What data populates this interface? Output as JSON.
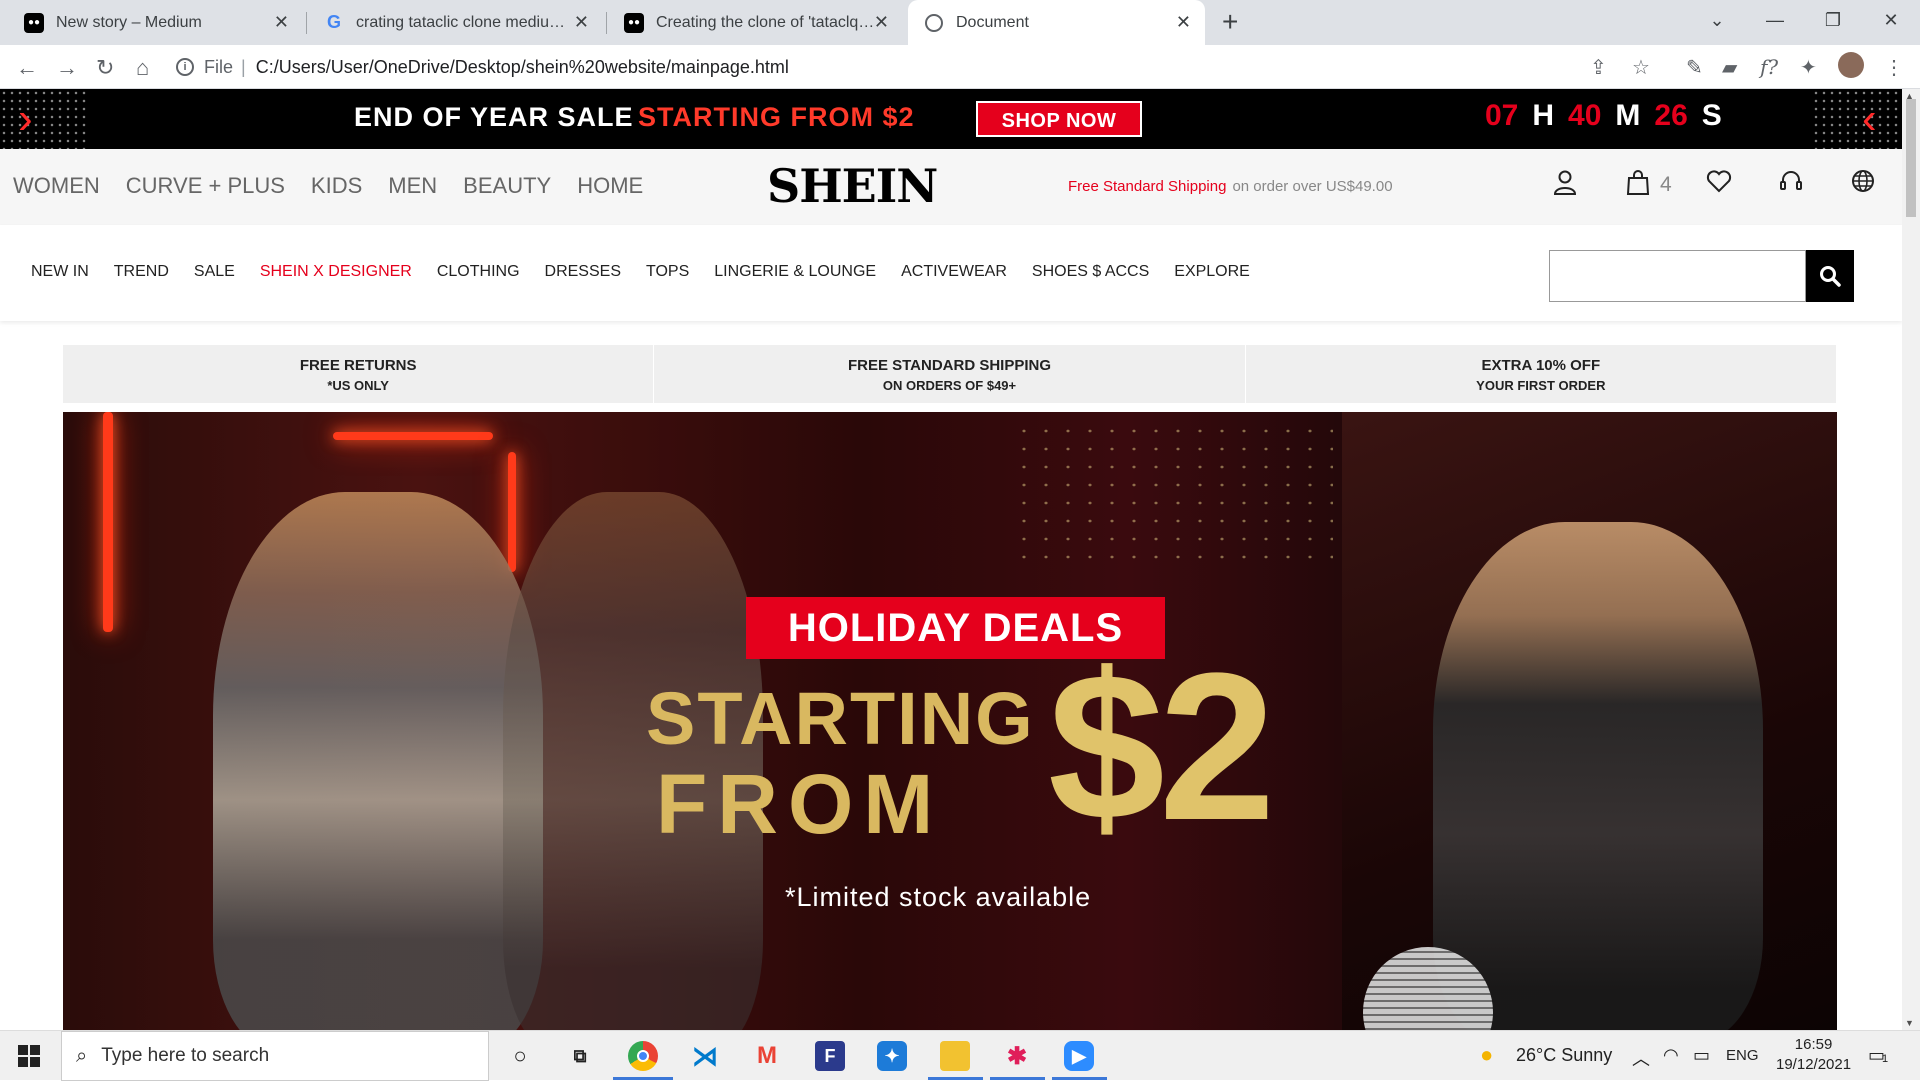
{
  "browser": {
    "tabs": [
      {
        "title": "New story – Medium",
        "icon": "medium-icon"
      },
      {
        "title": "crating tataclic clone medium - G",
        "icon": "google-icon"
      },
      {
        "title": "Creating the clone of 'tataclq.co",
        "icon": "medium-icon"
      },
      {
        "title": "Document",
        "icon": "globe-icon",
        "active": true
      }
    ],
    "address": {
      "scheme": "File",
      "url": "C:/Users/User/OneDrive/Desktop/shein%20website/mainpage.html"
    }
  },
  "sale_banner": {
    "title": "END OF YEAR SALE",
    "highlight": "STARTING FROM $2",
    "cta": "SHOP NOW",
    "countdown": {
      "hours": "07",
      "h_label": "H",
      "minutes": "40",
      "m_label": "M",
      "seconds": "26",
      "s_label": "S"
    },
    "colors": {
      "accent": "#e5001c",
      "background": "#000000"
    }
  },
  "header": {
    "categories": [
      "WOMEN",
      "CURVE + PLUS",
      "KIDS",
      "MEN",
      "BEAUTY",
      "HOME"
    ],
    "logo": "SHEIN",
    "shipping_highlight": "Free Standard Shipping",
    "shipping_text": "on order over US$49.00",
    "bag_count": "4",
    "icons": [
      "user-icon",
      "bag-icon",
      "heart-icon",
      "headset-icon",
      "globe-icon"
    ]
  },
  "subnav": {
    "links": [
      "NEW IN",
      "TREND",
      "SALE",
      "SHEIN X DESIGNER",
      "CLOTHING",
      "DRESSES",
      "TOPS",
      "LINGERIE & LOUNGE",
      "ACTIVEWEAR",
      "SHOES $ ACCS",
      "EXPLORE"
    ],
    "highlight_link": "SHEIN X DESIGNER",
    "search_value": ""
  },
  "benefits": [
    {
      "title": "FREE RETURNS",
      "sub": "*US ONLY"
    },
    {
      "title": "FREE STANDARD SHIPPING",
      "sub": "ON ORDERS OF $49+"
    },
    {
      "title": "EXTRA 10% OFF",
      "sub": "YOUR FIRST ORDER"
    }
  ],
  "hero": {
    "badge": "HOLIDAY DEALS",
    "line1": "STARTING",
    "line2": "FROM",
    "price": "$2",
    "note": "*Limited stock available"
  },
  "taskbar": {
    "search_placeholder": "Type here to search",
    "weather": "26°C  Sunny",
    "language": "ENG",
    "time": "16:59",
    "date": "19/12/2021",
    "notifications": "1"
  }
}
